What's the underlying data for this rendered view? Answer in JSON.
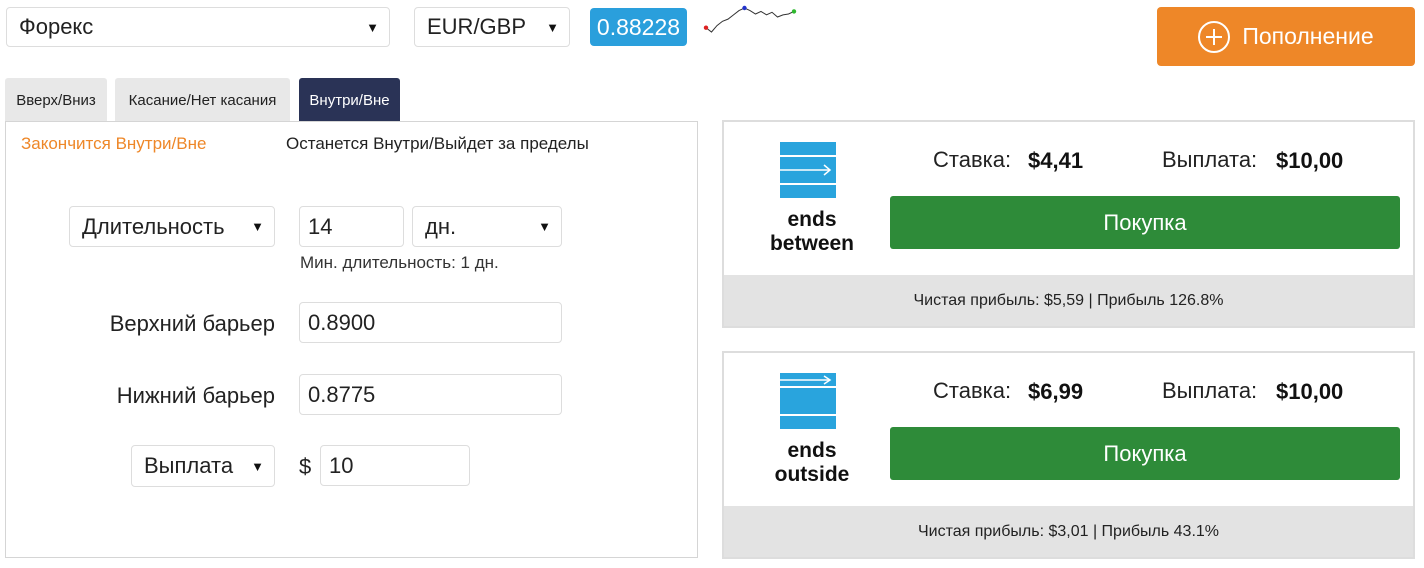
{
  "market": {
    "selected": "Форекс"
  },
  "pair": {
    "selected": "EUR/GBP"
  },
  "price": "0.88228",
  "sparkline_values": [
    0.8819,
    0.8818,
    0.88195,
    0.88205,
    0.8821,
    0.8822,
    0.8823,
    0.88236,
    0.8823,
    0.88222,
    0.88228,
    0.8822,
    0.88226,
    0.88215,
    0.8822,
    0.88222,
    0.88228
  ],
  "colors": {
    "accent_orange": "#ee8728",
    "price_blue": "#2a9fdc",
    "buy_green": "#2e8b39",
    "tab_active": "#2a3356"
  },
  "deposit_button": {
    "label": "Пополнение",
    "icon": "plus-circle-icon"
  },
  "tabs": [
    {
      "label": "Вверх/Вниз",
      "active": false
    },
    {
      "label": "Касание/Нет касания",
      "active": false
    },
    {
      "label": "Внутри/Вне",
      "active": true
    }
  ],
  "subtabs": [
    {
      "label": "Закончится Внутри/Вне",
      "active": true
    },
    {
      "label": "Останется Внутри/Выйдет за пределы",
      "active": false
    }
  ],
  "form": {
    "duration_type": "Длительность",
    "duration_value": "14",
    "duration_unit": "дн.",
    "min_duration_hint": "Мин. длительность: 1 дн.",
    "upper_barrier_label": "Верхний барьер",
    "upper_barrier_value": "0.8900",
    "lower_barrier_label": "Нижний барьер",
    "lower_barrier_value": "0.8775",
    "amount_type": "Выплата",
    "currency_symbol": "$",
    "amount_value": "10"
  },
  "contracts": [
    {
      "icon": "ends-between-icon",
      "label_line1": "ends",
      "label_line2": "between",
      "stake_label": "Ставка:",
      "stake_value": "$4,41",
      "payout_label": "Выплата:",
      "payout_value": "$10,00",
      "buy_label": "Покупка",
      "profit_text": "Чистая прибыль: $5,59 | Прибыль 126.8%"
    },
    {
      "icon": "ends-outside-icon",
      "label_line1": "ends",
      "label_line2": "outside",
      "stake_label": "Ставка:",
      "stake_value": "$6,99",
      "payout_label": "Выплата:",
      "payout_value": "$10,00",
      "buy_label": "Покупка",
      "profit_text": "Чистая прибыль: $3,01 | Прибыль 43.1%"
    }
  ]
}
